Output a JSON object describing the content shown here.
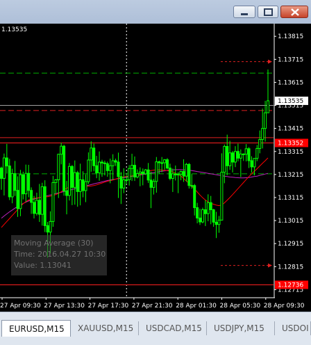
{
  "window": {
    "buttons": [
      "minimize",
      "maximize",
      "close"
    ]
  },
  "chart_data": {
    "type": "candlestick",
    "symbol": "EURUSD",
    "timeframe": "M15",
    "top_left_label": "1.13535",
    "price_axis": {
      "range": [
        1.1268,
        1.1387
      ],
      "ticks": [
        "1.13815",
        "1.13715",
        "1.13615",
        "1.13515",
        "1.13415",
        "1.13315",
        "1.13215",
        "1.13115",
        "1.13015",
        "1.12915",
        "1.12815",
        "1.12715"
      ],
      "current_price_label": "1.13535",
      "red_labels": [
        "1.13352",
        "1.12736"
      ]
    },
    "time_axis": {
      "labels": [
        "27 Apr 09:30",
        "27 Apr 13:30",
        "27 Apr 17:30",
        "27 Apr 21:30",
        "28 Apr 01:30",
        "28 Apr 05:30",
        "28 Apr 09:30"
      ]
    },
    "ohlc": [
      [
        1.13243,
        1.13249,
        1.13149,
        1.13198
      ],
      [
        1.13198,
        1.13306,
        1.13124,
        1.13287
      ],
      [
        1.13287,
        1.13348,
        1.13219,
        1.13252
      ],
      [
        1.13252,
        1.13283,
        1.13104,
        1.13118
      ],
      [
        1.13118,
        1.1324,
        1.1309,
        1.13219
      ],
      [
        1.13219,
        1.13274,
        1.13122,
        1.13146
      ],
      [
        1.13146,
        1.13207,
        1.13031,
        1.13067
      ],
      [
        1.13067,
        1.13235,
        1.13034,
        1.13214
      ],
      [
        1.13214,
        1.13227,
        1.13107,
        1.13131
      ],
      [
        1.13131,
        1.13258,
        1.13096,
        1.1322
      ],
      [
        1.1322,
        1.13257,
        1.13116,
        1.13146
      ],
      [
        1.13146,
        1.13159,
        1.13044,
        1.13094
      ],
      [
        1.13094,
        1.13122,
        1.13024,
        1.13046
      ],
      [
        1.13046,
        1.13136,
        1.13037,
        1.13103
      ],
      [
        1.13103,
        1.13174,
        1.13009,
        1.13042
      ],
      [
        1.13042,
        1.13179,
        1.12993,
        1.13162
      ],
      [
        1.13162,
        1.1319,
        1.12965,
        1.12993
      ],
      [
        1.12993,
        1.13009,
        1.12854,
        1.12965
      ],
      [
        1.12965,
        1.13055,
        1.12872,
        1.13011
      ],
      [
        1.13011,
        1.13209,
        1.12988,
        1.1318
      ],
      [
        1.1318,
        1.13195,
        1.13131,
        1.13192
      ],
      [
        1.13192,
        1.13305,
        1.13113,
        1.13303
      ],
      [
        1.13303,
        1.13353,
        1.13259,
        1.13338
      ],
      [
        1.13338,
        1.13344,
        1.13123,
        1.13144
      ],
      [
        1.13144,
        1.13187,
        1.13042,
        1.13124
      ],
      [
        1.13124,
        1.13265,
        1.13102,
        1.1325
      ],
      [
        1.1325,
        1.13256,
        1.13082,
        1.13159
      ],
      [
        1.13159,
        1.13276,
        1.13084,
        1.13223
      ],
      [
        1.13223,
        1.13231,
        1.13075,
        1.13141
      ],
      [
        1.13141,
        1.13262,
        1.13081,
        1.13192
      ],
      [
        1.13192,
        1.13229,
        1.13116,
        1.13145
      ],
      [
        1.13145,
        1.13215,
        1.13095,
        1.13184
      ],
      [
        1.13184,
        1.13311,
        1.13174,
        1.13278
      ],
      [
        1.13278,
        1.13359,
        1.13227,
        1.1333
      ],
      [
        1.1333,
        1.13349,
        1.13229,
        1.13253
      ],
      [
        1.13253,
        1.13296,
        1.13199,
        1.13222
      ],
      [
        1.13222,
        1.13315,
        1.13188,
        1.13269
      ],
      [
        1.13269,
        1.13279,
        1.13205,
        1.13265
      ],
      [
        1.13265,
        1.13275,
        1.13211,
        1.13262
      ],
      [
        1.13262,
        1.13271,
        1.13205,
        1.13232
      ],
      [
        1.13232,
        1.13284,
        1.13177,
        1.13253
      ],
      [
        1.13253,
        1.13303,
        1.13191,
        1.13275
      ],
      [
        1.13275,
        1.13284,
        1.13252,
        1.13269
      ],
      [
        1.13269,
        1.1331,
        1.13113,
        1.13206
      ],
      [
        1.13206,
        1.13226,
        1.13087,
        1.13156
      ],
      [
        1.13156,
        1.13242,
        1.13134,
        1.13192
      ],
      [
        1.13192,
        1.13212,
        1.13173,
        1.13192
      ],
      [
        1.13192,
        1.13256,
        1.13167,
        1.13241
      ],
      [
        1.13241,
        1.13305,
        1.13187,
        1.13255
      ],
      [
        1.13255,
        1.13293,
        1.13187,
        1.13204
      ],
      [
        1.13204,
        1.13237,
        1.13198,
        1.13219
      ],
      [
        1.13219,
        1.13246,
        1.13164,
        1.13226
      ],
      [
        1.13226,
        1.13241,
        1.13168,
        1.13218
      ],
      [
        1.13218,
        1.13239,
        1.13213,
        1.13235
      ],
      [
        1.13235,
        1.13265,
        1.13178,
        1.13191
      ],
      [
        1.13191,
        1.13227,
        1.13069,
        1.13159
      ],
      [
        1.13159,
        1.13196,
        1.13128,
        1.13185
      ],
      [
        1.13185,
        1.13291,
        1.13136,
        1.1327
      ],
      [
        1.1327,
        1.13275,
        1.13219,
        1.13266
      ],
      [
        1.13266,
        1.13291,
        1.13225,
        1.13266
      ],
      [
        1.13266,
        1.13282,
        1.13236,
        1.13279
      ],
      [
        1.13279,
        1.13286,
        1.13238,
        1.13243
      ],
      [
        1.13243,
        1.13262,
        1.1319,
        1.13198
      ],
      [
        1.13198,
        1.13241,
        1.13139,
        1.13218
      ],
      [
        1.13218,
        1.13254,
        1.13189,
        1.13213
      ],
      [
        1.13213,
        1.13225,
        1.13134,
        1.13216
      ],
      [
        1.13216,
        1.13232,
        1.1319,
        1.13228
      ],
      [
        1.13228,
        1.13281,
        1.13183,
        1.13208
      ],
      [
        1.13208,
        1.13265,
        1.13184,
        1.13259
      ],
      [
        1.13259,
        1.13265,
        1.13154,
        1.13167
      ],
      [
        1.13167,
        1.13217,
        1.13153,
        1.13167
      ],
      [
        1.13167,
        1.13174,
        1.13037,
        1.13071
      ],
      [
        1.13071,
        1.13092,
        1.13003,
        1.13026
      ],
      [
        1.13026,
        1.13066,
        1.12996,
        1.13009
      ],
      [
        1.13009,
        1.13071,
        1.13003,
        1.13062
      ],
      [
        1.13062,
        1.13104,
        1.12991,
        1.13045
      ],
      [
        1.13045,
        1.13129,
        1.13012,
        1.13093
      ],
      [
        1.13093,
        1.13122,
        1.12999,
        1.13062
      ],
      [
        1.13062,
        1.13066,
        1.12988,
        1.13008
      ],
      [
        1.13008,
        1.13053,
        1.12939,
        1.12998
      ],
      [
        1.12998,
        1.13035,
        1.12962,
        1.13017
      ],
      [
        1.13017,
        1.13307,
        1.13015,
        1.13225
      ],
      [
        1.13225,
        1.13345,
        1.13177,
        1.13337
      ],
      [
        1.13337,
        1.13388,
        1.13212,
        1.13253
      ],
      [
        1.13253,
        1.13361,
        1.13235,
        1.13309
      ],
      [
        1.13309,
        1.13317,
        1.13224,
        1.13269
      ],
      [
        1.13269,
        1.13338,
        1.13247,
        1.13315
      ],
      [
        1.13315,
        1.13349,
        1.13272,
        1.13286
      ],
      [
        1.13286,
        1.13324,
        1.13204,
        1.13304
      ],
      [
        1.13304,
        1.13307,
        1.13274,
        1.13303
      ],
      [
        1.13303,
        1.13347,
        1.13272,
        1.13327
      ],
      [
        1.13327,
        1.13334,
        1.13243,
        1.13275
      ],
      [
        1.13275,
        1.13294,
        1.13223,
        1.13248
      ],
      [
        1.13248,
        1.13286,
        1.13211,
        1.13285
      ],
      [
        1.13285,
        1.13343,
        1.13273,
        1.13328
      ],
      [
        1.13328,
        1.13406,
        1.13307,
        1.13367
      ],
      [
        1.13367,
        1.13501,
        1.13328,
        1.13415
      ],
      [
        1.13415,
        1.13535,
        1.13358,
        1.13483
      ],
      [
        1.13483,
        1.13671,
        1.13483,
        1.13535
      ]
    ],
    "candle_color": "#00ff00",
    "moving_average": {
      "label": "Moving Average (30)",
      "color": "#ff0000",
      "values": [
        1.12985,
        1.12998,
        1.13011,
        1.13024,
        1.13037,
        1.1305,
        1.13063,
        1.13076,
        1.13088,
        1.13097,
        1.13104,
        1.13108,
        1.13111,
        1.13113,
        1.13115,
        1.13117,
        1.13118,
        1.13119,
        1.13121,
        1.13124,
        1.13128,
        1.13133,
        1.1314,
        1.13148,
        1.13155,
        1.1316,
        1.13164,
        1.13166,
        1.13167,
        1.13166,
        1.13164,
        1.13164,
        1.13164,
        1.13165,
        1.13167,
        1.1317,
        1.13174,
        1.13178,
        1.13182,
        1.13186,
        1.13188,
        1.13191,
        1.13195,
        1.13199,
        1.13202,
        1.13205,
        1.13207,
        1.13208,
        1.13209,
        1.1321,
        1.13212,
        1.13215,
        1.13219,
        1.13224,
        1.13229,
        1.13232,
        1.13234,
        1.13235,
        1.13235,
        1.13234,
        1.13233,
        1.13232,
        1.1323,
        1.13226,
        1.13221,
        1.13215,
        1.13208,
        1.13198,
        1.13187,
        1.13176,
        1.13164,
        1.13152,
        1.13139,
        1.13126,
        1.13114,
        1.13104,
        1.13096,
        1.1309,
        1.13086,
        1.13082,
        1.1308,
        1.13083,
        1.13092,
        1.13103,
        1.13115,
        1.13128,
        1.13141,
        1.13154,
        1.13167,
        1.1318,
        1.13193,
        1.13206,
        1.13218,
        1.13229,
        1.1324,
        1.13252,
        1.13264,
        1.13275,
        1.13287
      ]
    },
    "moving_average_2": {
      "color": "#c020c0",
      "values": [
        1.13025,
        1.13035,
        1.13044,
        1.13053,
        1.13061,
        1.13069,
        1.13076,
        1.13083,
        1.13089,
        1.13095,
        1.131,
        1.13104,
        1.13108,
        1.13111,
        1.13114,
        1.13117,
        1.1312,
        1.13123,
        1.13126,
        1.13129,
        1.13132,
        1.13135,
        1.13138,
        1.13141,
        1.13144,
        1.13147,
        1.1315,
        1.13153,
        1.13156,
        1.13159,
        1.13162,
        1.13165,
        1.13168,
        1.13171,
        1.13174,
        1.13177,
        1.1318,
        1.13183,
        1.13186,
        1.13189,
        1.13191,
        1.13193,
        1.13195,
        1.13197,
        1.13199,
        1.13201,
        1.13203,
        1.13205,
        1.13207,
        1.13209,
        1.13211,
        1.13213,
        1.13215,
        1.13217,
        1.13219,
        1.13221,
        1.13223,
        1.13225,
        1.13227,
        1.13229,
        1.13231,
        1.13233,
        1.13234,
        1.13235,
        1.13236,
        1.13236,
        1.13236,
        1.13235,
        1.13234,
        1.13233,
        1.13232,
        1.1323,
        1.13228,
        1.13226,
        1.13224,
        1.13222,
        1.1322,
        1.13218,
        1.13216,
        1.13214,
        1.13212,
        1.1321,
        1.13208,
        1.13206,
        1.13204,
        1.13203,
        1.13202,
        1.13201,
        1.132,
        1.132,
        1.13201,
        1.13202,
        1.13204,
        1.13206,
        1.13208,
        1.13211,
        1.13214,
        1.13217,
        1.1322
      ]
    },
    "horizontal_lines": [
      {
        "price": 1.13655,
        "color": "#00b000",
        "style": "dashed"
      },
      {
        "price": 1.13515,
        "color": "#a0a0a0",
        "style": "solid"
      },
      {
        "price": 1.13493,
        "color": "#e02020",
        "style": "dashed"
      },
      {
        "price": 1.13375,
        "color": "#e02020",
        "style": "solid"
      },
      {
        "price": 1.13352,
        "color": "#ff2020",
        "style": "solid"
      },
      {
        "price": 1.13218,
        "color": "#00b000",
        "style": "dashed"
      },
      {
        "price": 1.12736,
        "color": "#ff2020",
        "style": "solid"
      }
    ],
    "stop_arrows": [
      1.13705,
      1.1282
    ],
    "vertical_line_time_index": 46,
    "tooltip": {
      "lines": [
        "Moving Average (30)",
        "Time: 2016.04.27 10:30",
        "Value: 1.13041"
      ]
    }
  },
  "tabs": [
    {
      "label": "EURUSD,M15",
      "active": true
    },
    {
      "label": "XAUUSD,M15",
      "active": false
    },
    {
      "label": "USDCAD,M15",
      "active": false
    },
    {
      "label": "USDJPY,M15",
      "active": false
    },
    {
      "label": "USDOI",
      "active": false
    }
  ]
}
